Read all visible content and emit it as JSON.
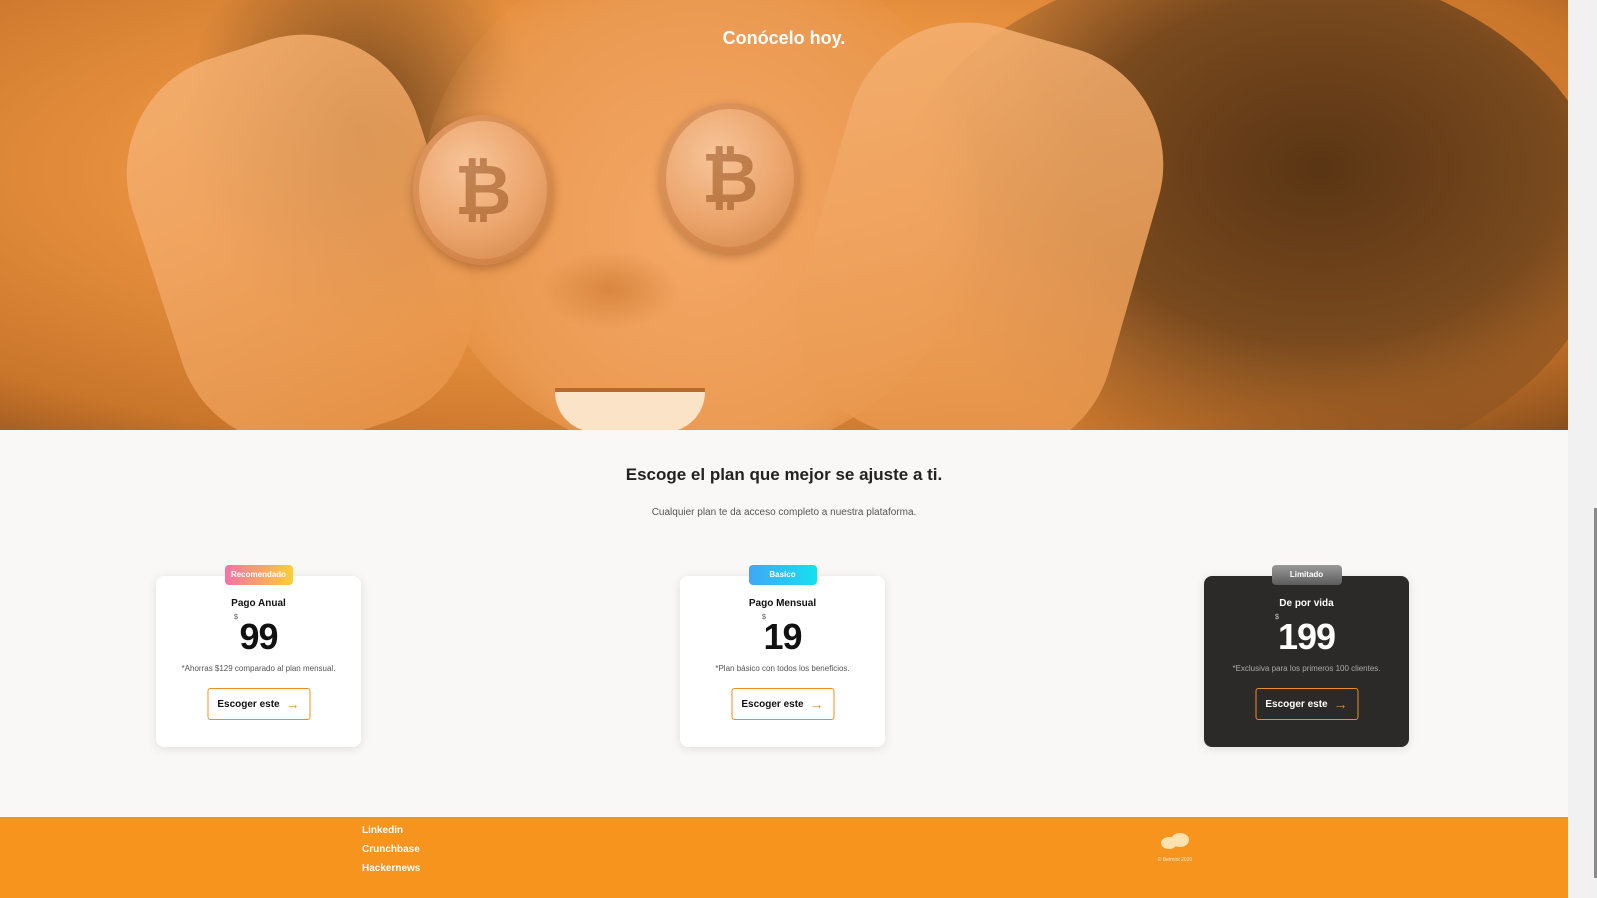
{
  "hero": {
    "title": "Conócelo hoy."
  },
  "plans": {
    "title": "Escoge el plan que mejor se ajuste a ti.",
    "subtitle": "Cualquier plan te da acceso completo a nuestra plataforma.",
    "cards": [
      {
        "badge": "Recomendado",
        "name": "Pago Anual",
        "currency": "$",
        "price": "99",
        "note": "*Ahorras $129 comparado al plan mensual.",
        "cta": "Escoger este"
      },
      {
        "badge": "Basico",
        "name": "Pago Mensual",
        "currency": "$",
        "price": "19",
        "note": "*Plan básico con todos los beneficios.",
        "cta": "Escoger este"
      },
      {
        "badge": "Limitado",
        "name": "De por vida",
        "currency": "$",
        "price": "199",
        "note": "*Exclusiva para los primeros 100 clientes.",
        "cta": "Escoger este"
      }
    ]
  },
  "footer": {
    "links": [
      "Linkedin",
      "Crunchbase",
      "Hackernews"
    ],
    "copyright": "© Betmint 2020"
  },
  "colors": {
    "accent": "#f7941d",
    "hero_tint": "#e8913f",
    "dark_card": "#2b2a28"
  },
  "icons": {
    "cta_arrow": "arrow-right-icon",
    "logo": "logo-icon"
  }
}
